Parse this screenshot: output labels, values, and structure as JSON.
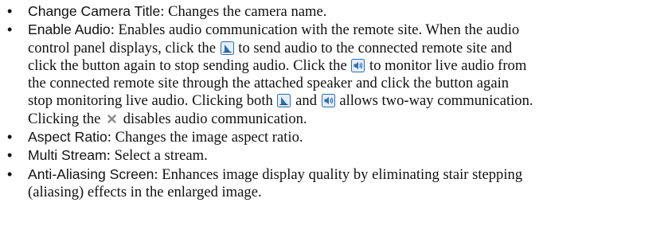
{
  "items": [
    {
      "term": "Change Camera Title",
      "desc": "Changes the camera name."
    },
    {
      "term": "Enable Audio",
      "desc_lines": [
        "Enables audio communication with the remote site.  When the audio",
        "control panel displays, click the",
        "to send audio to the connected remote site and",
        "click the button again to stop sending audio.  Click the",
        "to monitor live audio from",
        "the connected remote site through the attached speaker and click the button again",
        "stop monitoring live audio.  Clicking both",
        "and",
        "allows two-way communication.",
        "Clicking the",
        "disables audio communication."
      ]
    },
    {
      "term": "Aspect Ratio",
      "desc": "Changes the image aspect ratio."
    },
    {
      "term": "Multi Stream",
      "desc": "Select a stream."
    },
    {
      "term": "Anti-Aliasing Screen",
      "desc_lines": [
        "Enhances image display quality by eliminating stair stepping",
        "(aliasing) effects in the enlarged image."
      ]
    }
  ],
  "bullet_char": "•",
  "colon": ":",
  "icons": {
    "microphone": "microphone-icon",
    "speaker": "speaker-icon",
    "close": "close-icon"
  },
  "colors": {
    "text": "#111111",
    "icon_frame": "#2f6fb0",
    "icon_fill": "#e4eef9",
    "close_x": "#8a8a8a"
  }
}
